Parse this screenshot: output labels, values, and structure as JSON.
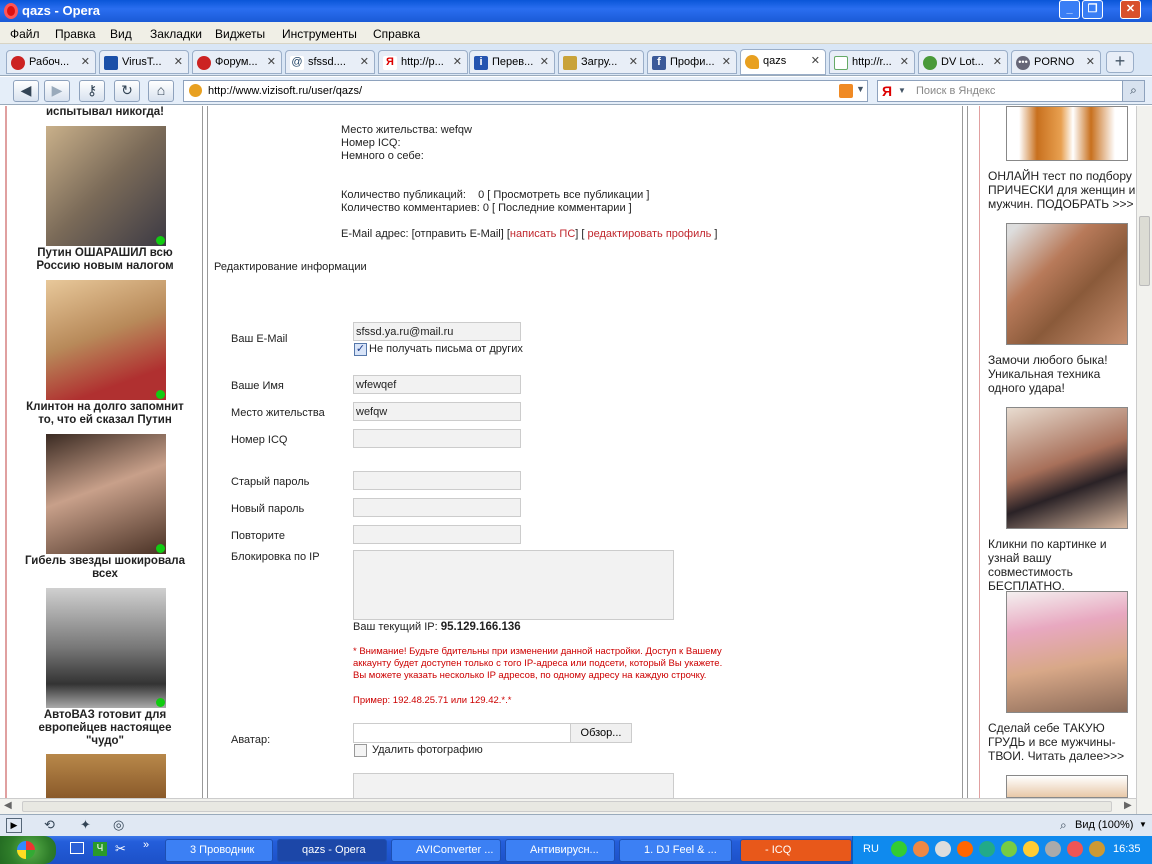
{
  "window": {
    "title": "qazs - Opera"
  },
  "menu": [
    "Файл",
    "Правка",
    "Вид",
    "Закладки",
    "Виджеты",
    "Инструменты",
    "Справка"
  ],
  "tabs": [
    {
      "label": "Рабоч...",
      "icon": "opera-icon"
    },
    {
      "label": "VirusT...",
      "icon": "virustotal-icon"
    },
    {
      "label": "Форум...",
      "icon": "opera-icon"
    },
    {
      "label": "sfssd....",
      "icon": "mail-icon"
    },
    {
      "label": "http://p...",
      "icon": "yandex-icon"
    },
    {
      "label": "Перев...",
      "icon": "info-icon"
    },
    {
      "label": "Загру...",
      "icon": "download-icon"
    },
    {
      "label": "Профи...",
      "icon": "facebook-icon"
    },
    {
      "label": "qazs",
      "icon": "broom-icon"
    },
    {
      "label": "http://r...",
      "icon": "page-icon"
    },
    {
      "label": "DV Lot...",
      "icon": "globe-icon"
    },
    {
      "label": "PORNO",
      "icon": "dots-icon"
    }
  ],
  "address": {
    "url": "http://www.vizisoft.ru/user/qazs/",
    "search_placeholder": "Поиск в Яндекс",
    "search_engine": "Я"
  },
  "left_ads": [
    {
      "caption_top": "испытывал никогда!"
    },
    {
      "caption": "Путин ОШАРАШИЛ всю Россию новым налогом"
    },
    {
      "caption": "Клинтон на долго запомнит то, что ей сказал Путин"
    },
    {
      "caption": "Гибель звезды шокировала всех"
    },
    {
      "caption": "АвтоВАЗ готовит для европейцев настоящее \"чудо\""
    }
  ],
  "profile": {
    "residence": "Место жительства: wefqw",
    "icq": "Номер ICQ:",
    "about": "Немного о себе:",
    "publications": "Количество публикаций:    0 [ Просмотреть все публикации ]",
    "comments": "Количество комментариев: 0 [ Последние комментарии ]",
    "email_prefix": "E-Mail адрес: [отправить E-Mail] [",
    "write_pm": "написать ПС",
    "mid": "] [",
    "edit_profile": "редактировать профиль",
    "suffix": " ]"
  },
  "edit": {
    "heading": "Редактирование информации",
    "email_label": "Ваш E-Mail",
    "email_value": "sfssd.ya.ru@mail.ru",
    "no_mail_label": "Не получать письма от других",
    "name_label": "Ваше Имя",
    "name_value": "wfewqef",
    "residence_label": "Место жительства",
    "residence_value": "wefqw",
    "icq_label": "Номер ICQ",
    "icq_value": "",
    "old_pw_label": "Старый пароль",
    "new_pw_label": "Новый пароль",
    "repeat_label": "Повторите",
    "ip_block_label": "Блокировка по IP",
    "current_ip_label": "Ваш текущий IP: ",
    "current_ip": "95.129.166.136",
    "warning": "* Внимание! Будьте бдительны при изменении данной настройки. Доступ к Вашему аккаунту будет доступен только с того IP-адреса или подсети, который Вы укажете. Вы можете указать несколько IP адресов, по одному адресу на каждую строчку.",
    "example": "Пример: 192.48.25.71 или 129.42.*.*",
    "avatar_label": "Аватар:",
    "browse": "Обзор...",
    "delete_photo": "Удалить фотографию"
  },
  "right_ads": [
    {
      "caption": "ОНЛАЙН тест по подбору ПРИЧЕСКИ для женщин и мужчин. ПОДОБРАТЬ >>>"
    },
    {
      "caption": "Замочи любого быка! Уникальная техника одного удара!"
    },
    {
      "caption": "Кликни по картинке и узнай вашу совместимость БЕСПЛАТНО."
    },
    {
      "caption": "Сделай себе ТАКУЮ ГРУДЬ и все мужчины-ТВОИ. Читать далее>>>"
    }
  ],
  "status": {
    "zoom": "Вид (100%)"
  },
  "taskbar": {
    "items": [
      {
        "label": "3 Проводник"
      },
      {
        "label": "qazs - Opera"
      },
      {
        "label": "AVIConverter ..."
      },
      {
        "label": "Антивирусн..."
      },
      {
        "label": "1. DJ Feel & ..."
      },
      {
        "label": "- ICQ"
      }
    ],
    "lang": "RU",
    "clock": "16:35"
  },
  "colors": {
    "link": "#c0262d",
    "warning": "#cc0000",
    "online": "#22cc22"
  }
}
